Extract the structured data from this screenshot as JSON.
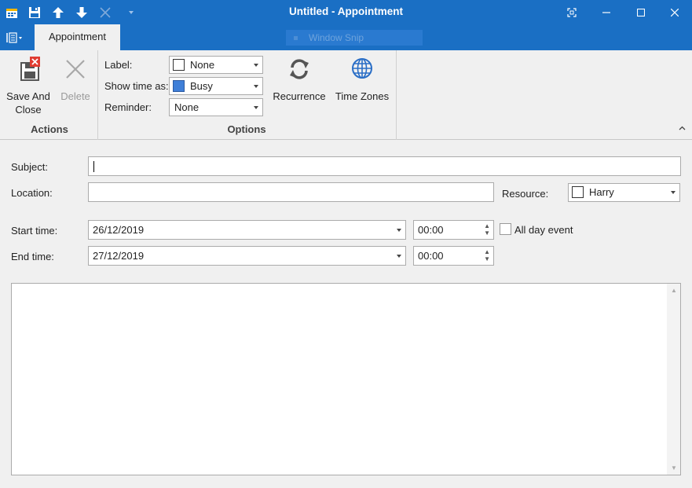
{
  "window": {
    "title": "Untitled - Appointment"
  },
  "quick_access": {
    "icons": [
      "calendar-app-icon",
      "save-icon",
      "arrow-up-icon",
      "arrow-down-icon",
      "close-disabled-icon",
      "customize-dropdown-icon"
    ]
  },
  "tabs": {
    "appointment_label": "Appointment",
    "overlay_text": "Window Snip"
  },
  "ribbon": {
    "actions": {
      "group_label": "Actions",
      "save_and_close_line1": "Save And",
      "save_and_close_line2": "Close",
      "delete_label": "Delete"
    },
    "options": {
      "group_label": "Options",
      "label_caption": "Label:",
      "label_value": "None",
      "label_color": "#ffffff",
      "show_time_caption": "Show time as:",
      "show_time_value": "Busy",
      "show_time_color": "#3f7fd8",
      "reminder_caption": "Reminder:",
      "reminder_value": "None",
      "recurrence_label": "Recurrence",
      "time_zones_label": "Time Zones"
    }
  },
  "form": {
    "subject_label": "Subject:",
    "subject_value": "",
    "location_label": "Location:",
    "location_value": "",
    "resource_label": "Resource:",
    "resource_value": "Harry",
    "start_time_label": "Start time:",
    "start_date": "26/12/2019",
    "start_time": "00:00",
    "all_day_label": "All day event",
    "end_time_label": "End time:",
    "end_date": "27/12/2019",
    "end_time": "00:00",
    "notes": ""
  },
  "colors": {
    "titlebar": "#1a6fc4",
    "ribbon_bg": "#f0f0f0",
    "save_badge": "#e03c31"
  }
}
